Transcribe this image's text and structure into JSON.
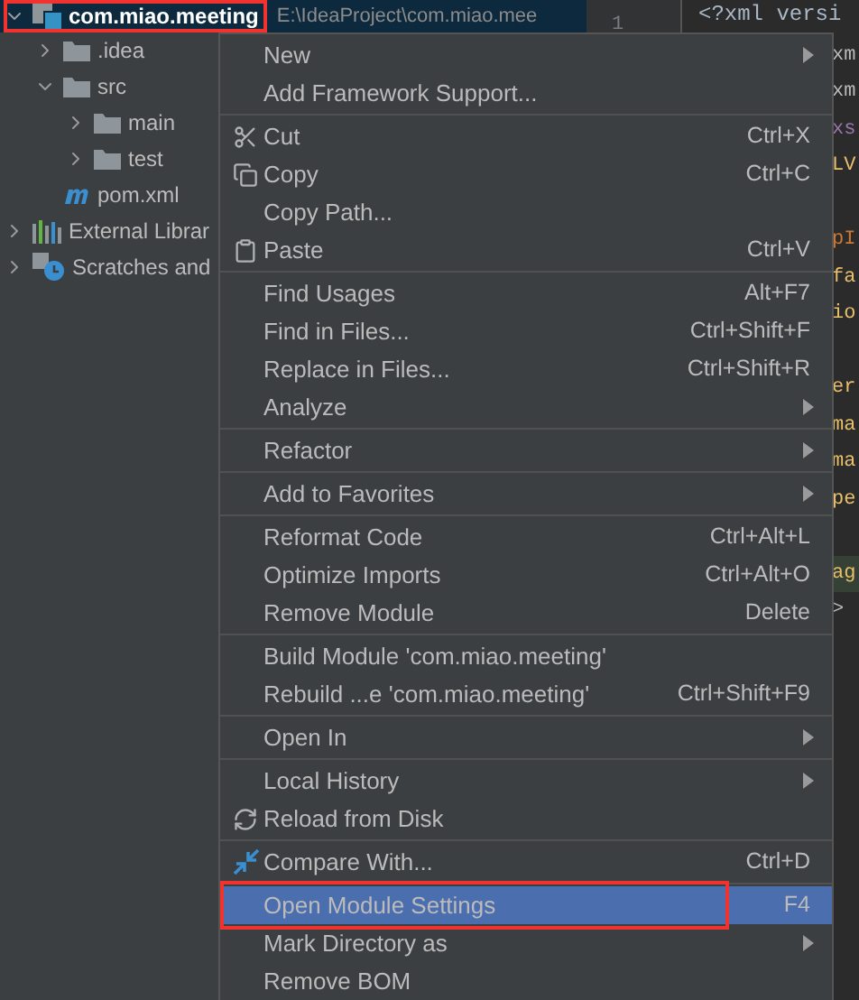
{
  "project_tree": {
    "root": {
      "label": "com.miao.meeting",
      "path": "E:\\IdeaProject\\com.miao.mee",
      "selected": true,
      "annotated": true,
      "expanded": true
    },
    "items": [
      {
        "label": ".idea",
        "kind": "folder",
        "expanded": false
      },
      {
        "label": "src",
        "kind": "folder",
        "expanded": true,
        "children": [
          {
            "label": "main",
            "kind": "folder",
            "expanded": false
          },
          {
            "label": "test",
            "kind": "folder",
            "expanded": false
          }
        ]
      },
      {
        "label": "pom.xml",
        "kind": "maven"
      }
    ],
    "extra": [
      {
        "label": "External Librar",
        "kind": "libraries",
        "expanded": false
      },
      {
        "label": "Scratches and",
        "kind": "scratches",
        "expanded": false
      }
    ]
  },
  "gutter": {
    "line_number": "1"
  },
  "editor": {
    "lines": [
      {
        "kind": "full",
        "text": "<?xml versi",
        "color": "#a9b7c6"
      },
      {
        "kind": "tail",
        "text": "xm",
        "color": "#bababa"
      },
      {
        "kind": "tail",
        "text": "xm",
        "color": "#bababa"
      },
      {
        "kind": "tail",
        "text": "xs",
        "color": "#9876aa"
      },
      {
        "kind": "tail",
        "text": "LV",
        "color": "#e8bf6a"
      },
      {
        "kind": "blank"
      },
      {
        "kind": "tail",
        "text": "pI",
        "color": "#cc7832"
      },
      {
        "kind": "tail",
        "text": "fa",
        "color": "#e8bf6a"
      },
      {
        "kind": "tail",
        "text": "io",
        "color": "#e8bf6a"
      },
      {
        "kind": "blank"
      },
      {
        "kind": "tail",
        "text": "er",
        "color": "#e8bf6a"
      },
      {
        "kind": "tail",
        "text": "ma",
        "color": "#e8bf6a"
      },
      {
        "kind": "tail",
        "text": "ma",
        "color": "#e8bf6a"
      },
      {
        "kind": "tail",
        "text": "pe",
        "color": "#e8bf6a"
      },
      {
        "kind": "blank"
      },
      {
        "kind": "tail",
        "text": "ag",
        "color": "#e8bf6a",
        "highlighted": true
      },
      {
        "kind": "tail",
        "text": ">",
        "color": "#bababa"
      }
    ]
  },
  "context_menu": {
    "groups": [
      [
        {
          "label": "New",
          "submenu": true
        },
        {
          "label": "Add Framework Support..."
        }
      ],
      [
        {
          "label": "Cut",
          "shortcut": "Ctrl+X",
          "kind": "cut"
        },
        {
          "label": "Copy",
          "shortcut": "Ctrl+C",
          "kind": "copy"
        },
        {
          "label": "Copy Path..."
        },
        {
          "label": "Paste",
          "shortcut": "Ctrl+V",
          "kind": "paste"
        }
      ],
      [
        {
          "label": "Find Usages",
          "shortcut": "Alt+F7"
        },
        {
          "label": "Find in Files...",
          "shortcut": "Ctrl+Shift+F"
        },
        {
          "label": "Replace in Files...",
          "shortcut": "Ctrl+Shift+R"
        },
        {
          "label": "Analyze",
          "submenu": true
        }
      ],
      [
        {
          "label": "Refactor",
          "submenu": true
        }
      ],
      [
        {
          "label": "Add to Favorites",
          "submenu": true
        }
      ],
      [
        {
          "label": "Reformat Code",
          "shortcut": "Ctrl+Alt+L"
        },
        {
          "label": "Optimize Imports",
          "shortcut": "Ctrl+Alt+O"
        },
        {
          "label": "Remove Module",
          "shortcut": "Delete"
        }
      ],
      [
        {
          "label": "Build Module 'com.miao.meeting'"
        },
        {
          "label": "Rebuild ...e 'com.miao.meeting'",
          "shortcut": "Ctrl+Shift+F9"
        }
      ],
      [
        {
          "label": "Open In",
          "submenu": true
        }
      ],
      [
        {
          "label": "Local History",
          "submenu": true
        },
        {
          "label": "Reload from Disk",
          "kind": "reload"
        }
      ],
      [
        {
          "label": "Compare With...",
          "shortcut": "Ctrl+D",
          "kind": "compare"
        }
      ],
      [
        {
          "label": "Open Module Settings",
          "shortcut": "F4",
          "selected": true,
          "annotated": true
        },
        {
          "label": "Mark Directory as",
          "submenu": true
        },
        {
          "label": "Remove BOM"
        }
      ]
    ]
  }
}
